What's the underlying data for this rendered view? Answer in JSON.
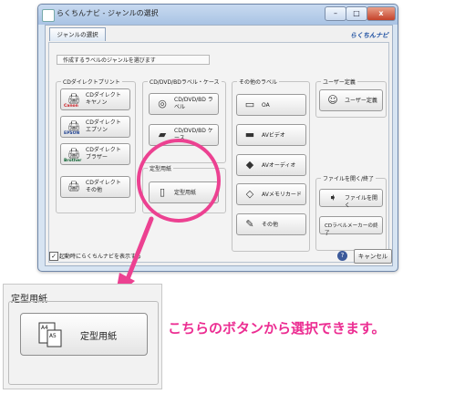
{
  "window": {
    "title": "らくちんナビ - ジャンルの選択",
    "controls": [
      "–",
      "□",
      "x"
    ]
  },
  "tab": {
    "label": "ジャンルの選択"
  },
  "logo": {
    "text": "らくちんナビ"
  },
  "prompt": "作成するラベルのジャンルを選びます",
  "groups": {
    "cd_direct": {
      "label": "CDダイレクトプリント",
      "buttons": [
        {
          "label": "CDダイレクト キヤノン",
          "brand": "Canon",
          "brand_color": "#c8161d"
        },
        {
          "label": "CDダイレクト エプソン",
          "brand": "EPSON",
          "brand_color": "#1d3f8e"
        },
        {
          "label": "CDダイレクト ブラザー",
          "brand": "Brother",
          "brand_color": "#0a5f2e"
        },
        {
          "label": "CDダイレクト その他",
          "brand": "",
          "brand_color": "#555555"
        }
      ]
    },
    "cd_dvd": {
      "label": "CD/DVD/BDラベル・ケース",
      "buttons": [
        {
          "label": "CD/DVD/BD ラベル",
          "icon": "disc-icon"
        },
        {
          "label": "CD/DVD/BD ケース",
          "icon": "case-icon"
        }
      ]
    },
    "fixed": {
      "label": "定型用紙",
      "button": {
        "label": "定型用紙",
        "icon": "a4-a5-paper-icon"
      }
    },
    "other": {
      "label": "その他のラベル",
      "buttons": [
        {
          "label": "OA",
          "icon": "oa-icon"
        },
        {
          "label": "AVビデオ",
          "icon": "videotape-icon"
        },
        {
          "label": "AVオーディオ",
          "icon": "audio-tape-icon"
        },
        {
          "label": "AVメモリカード",
          "icon": "memory-card-icon"
        },
        {
          "label": "その他",
          "icon": "misc-label-icon"
        }
      ]
    },
    "user": {
      "label": "ユーザー定義",
      "button": {
        "label": "ユーザー定義",
        "icon": "users-icon"
      }
    },
    "file": {
      "label": "ファイルを開く/終了",
      "buttons": [
        {
          "label": "ファイルを開く",
          "icon": "open-folder-icon"
        },
        {
          "label": "CDラベルメーカーの終了",
          "icon": ""
        }
      ]
    }
  },
  "footer": {
    "startup_checkbox_checked": true,
    "startup_label": "起動時にらくちんナビを表示する",
    "help": "?",
    "cancel": "キャンセル"
  },
  "zoom": {
    "group_label": "定型用紙",
    "button_label": "定型用紙",
    "icon_labels": [
      "A4",
      "A5"
    ]
  },
  "caption": "こちらのボタンから選択できます。",
  "colors": {
    "accent": "#ec4191",
    "caption": "#ec2d92"
  }
}
